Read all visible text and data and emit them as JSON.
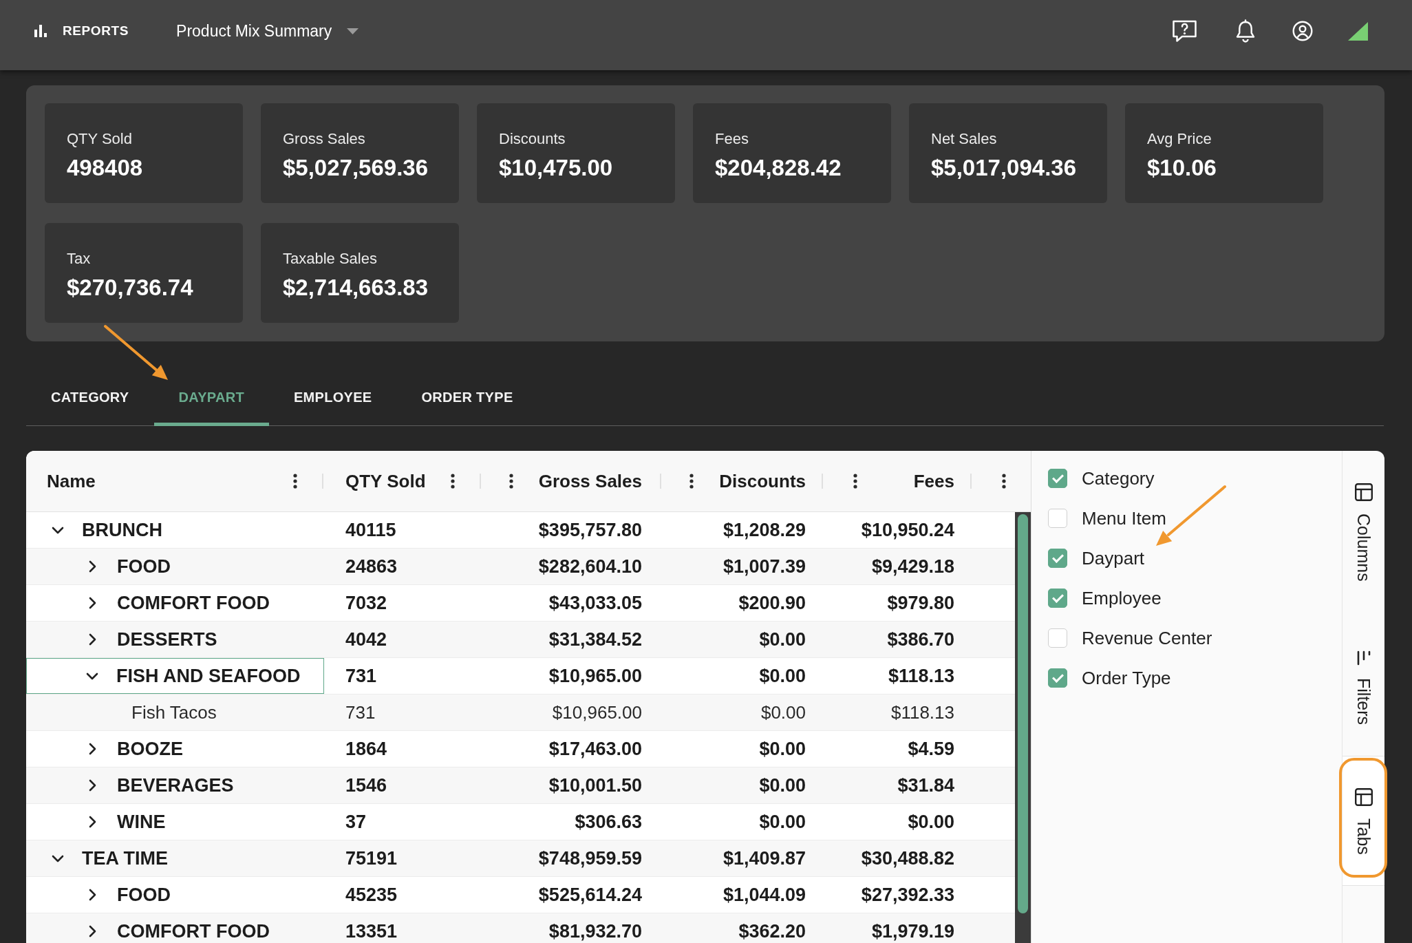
{
  "top_bar": {
    "section": "REPORTS",
    "report": "Product Mix Summary"
  },
  "metrics": [
    {
      "label": "QTY Sold",
      "value": "498408"
    },
    {
      "label": "Gross Sales",
      "value": "$5,027,569.36"
    },
    {
      "label": "Discounts",
      "value": "$10,475.00"
    },
    {
      "label": "Fees",
      "value": "$204,828.42"
    },
    {
      "label": "Net Sales",
      "value": "$5,017,094.36"
    },
    {
      "label": "Avg Price",
      "value": "$10.06"
    },
    {
      "label": "Tax",
      "value": "$270,736.74"
    },
    {
      "label": "Taxable Sales",
      "value": "$2,714,663.83"
    }
  ],
  "tabs": [
    {
      "label": "CATEGORY",
      "selected": false,
      "annotated": false
    },
    {
      "label": "DAYPART",
      "selected": true,
      "annotated": true
    },
    {
      "label": "EMPLOYEE",
      "selected": false,
      "annotated": false
    },
    {
      "label": "ORDER TYPE",
      "selected": false,
      "annotated": false
    }
  ],
  "table": {
    "columns": [
      "Name",
      "QTY Sold",
      "Gross Sales",
      "Discounts",
      "Fees"
    ],
    "rows": [
      {
        "kind": "group",
        "name": "BRUNCH",
        "expanded": true,
        "focused": false,
        "values": [
          "40115",
          "$395,757.80",
          "$1,208.29",
          "$10,950.24"
        ],
        "children": [
          {
            "kind": "group",
            "name": "FOOD",
            "expanded": false,
            "focused": false,
            "values": [
              "24863",
              "$282,604.10",
              "$1,007.39",
              "$9,429.18"
            ]
          },
          {
            "kind": "group",
            "name": "COMFORT FOOD",
            "expanded": false,
            "focused": false,
            "values": [
              "7032",
              "$43,033.05",
              "$200.90",
              "$979.80"
            ]
          },
          {
            "kind": "group",
            "name": "DESSERTS",
            "expanded": false,
            "focused": false,
            "values": [
              "4042",
              "$31,384.52",
              "$0.00",
              "$386.70"
            ]
          },
          {
            "kind": "group",
            "name": "FISH AND SEAFOOD",
            "expanded": true,
            "focused": true,
            "values": [
              "731",
              "$10,965.00",
              "$0.00",
              "$118.13"
            ],
            "children": [
              {
                "kind": "item",
                "name": "Fish Tacos",
                "focused": false,
                "values": [
                  "731",
                  "$10,965.00",
                  "$0.00",
                  "$118.13"
                ]
              }
            ]
          },
          {
            "kind": "group",
            "name": "BOOZE",
            "expanded": false,
            "focused": false,
            "values": [
              "1864",
              "$17,463.00",
              "$0.00",
              "$4.59"
            ]
          },
          {
            "kind": "group",
            "name": "BEVERAGES",
            "expanded": false,
            "focused": false,
            "values": [
              "1546",
              "$10,001.50",
              "$0.00",
              "$31.84"
            ]
          },
          {
            "kind": "group",
            "name": "WINE",
            "expanded": false,
            "focused": false,
            "values": [
              "37",
              "$306.63",
              "$0.00",
              "$0.00"
            ]
          }
        ]
      },
      {
        "kind": "group",
        "name": "TEA TIME",
        "expanded": true,
        "focused": false,
        "values": [
          "75191",
          "$748,959.59",
          "$1,409.87",
          "$30,488.82"
        ],
        "children": [
          {
            "kind": "group",
            "name": "FOOD",
            "expanded": false,
            "focused": false,
            "values": [
              "45235",
              "$525,614.24",
              "$1,044.09",
              "$27,392.33"
            ]
          },
          {
            "kind": "group",
            "name": "COMFORT FOOD",
            "expanded": false,
            "focused": false,
            "values": [
              "13351",
              "$81,932.70",
              "$362.20",
              "$1,979.19"
            ]
          }
        ]
      }
    ]
  },
  "tool_panel": {
    "annotation_arrow": true,
    "options": [
      {
        "label": "Category",
        "checked": true
      },
      {
        "label": "Menu Item",
        "checked": false
      },
      {
        "label": "Daypart",
        "checked": true
      },
      {
        "label": "Employee",
        "checked": true
      },
      {
        "label": "Revenue Center",
        "checked": false
      },
      {
        "label": "Order Type",
        "checked": true
      }
    ]
  },
  "side_tabs": [
    {
      "label": "Columns",
      "selected": false,
      "annotated": false
    },
    {
      "label": "Filters",
      "selected": false,
      "annotated": false
    },
    {
      "label": "Tabs",
      "selected": true,
      "annotated": true
    }
  ]
}
